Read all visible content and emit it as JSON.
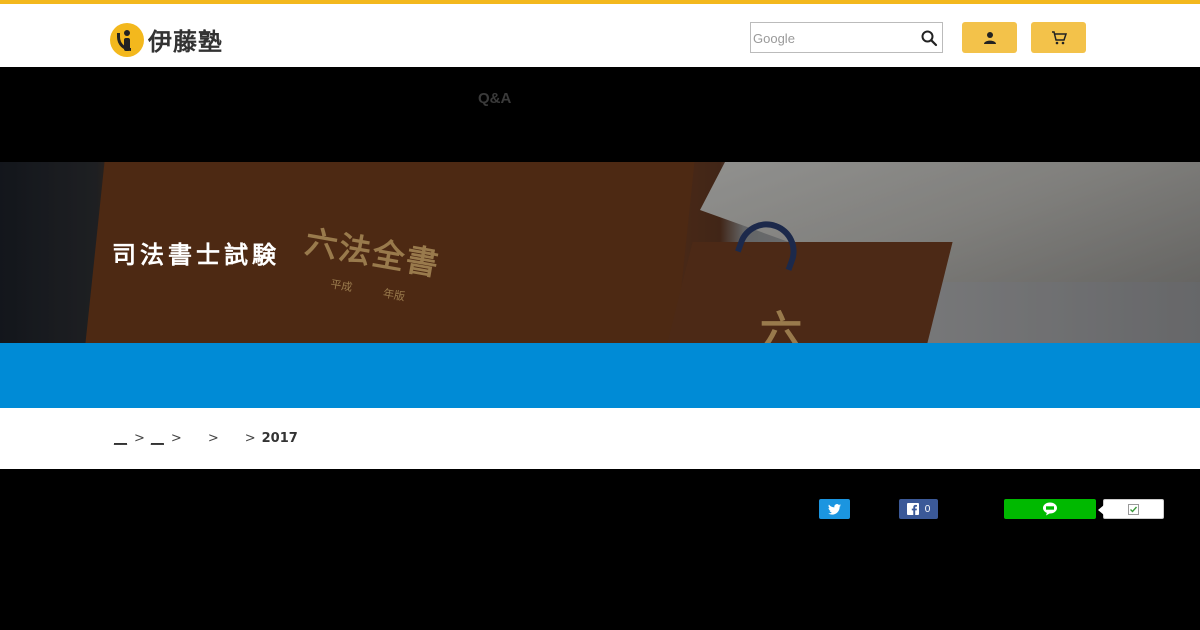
{
  "header": {
    "logo_text": "伊藤塾",
    "search": {
      "placeholder": "Google",
      "value": ""
    },
    "icons": {
      "search": "search-icon",
      "user": "user-icon",
      "cart": "cart-icon"
    }
  },
  "nav": {
    "items": [
      {
        "label": "Q&A"
      }
    ]
  },
  "hero": {
    "title": "司法書士試験",
    "book_title": "六法全書",
    "book_sub": "平成 年版",
    "spine_char": "六"
  },
  "breadcrumb": {
    "items": [
      {
        "label": "__"
      },
      {
        "label": "__"
      },
      {
        "label": ""
      },
      {
        "label": ""
      }
    ],
    "separator": ">",
    "current": "2017"
  },
  "share": {
    "facebook_count": "0",
    "icons": {
      "twitter": "twitter-icon",
      "facebook": "facebook-icon",
      "line": "line-icon",
      "hatena": "hatena-check-icon"
    }
  },
  "colors": {
    "brand_yellow": "#f3b81d",
    "button_yellow": "#f3c24a",
    "band_blue": "#008bd6",
    "twitter": "#1b95e0",
    "facebook": "#3b5998",
    "line": "#00b900"
  }
}
